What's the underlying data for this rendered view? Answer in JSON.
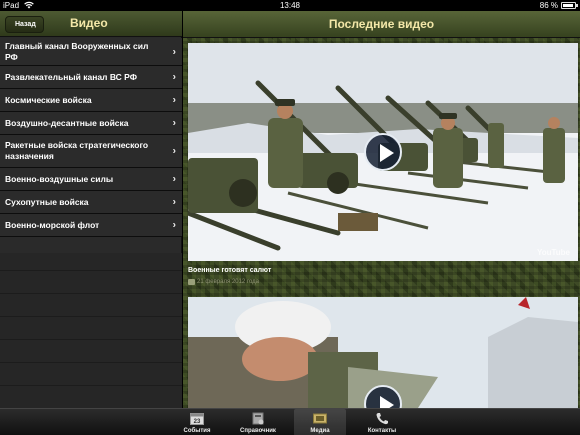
{
  "statusbar": {
    "carrier": "iPad",
    "time": "13:48",
    "battery": "86 %",
    "battery_level": 0.86
  },
  "left_panel": {
    "back_label": "Назад",
    "title": "Видео",
    "items": [
      {
        "label": "Главный канал Вооруженных сил РФ"
      },
      {
        "label": "Развлекательный канал ВС РФ"
      },
      {
        "label": "Космические войска"
      },
      {
        "label": "Воздушно-десантные войска"
      },
      {
        "label": "Ракетные войска стратегического назначения"
      },
      {
        "label": "Военно-воздушные силы"
      },
      {
        "label": "Сухопутные войска"
      },
      {
        "label": "Военно-морской флот"
      }
    ]
  },
  "right_panel": {
    "title": "Последние видео",
    "videos": [
      {
        "title": "Военные готовят салют",
        "date": "21 февраля 2012 года"
      },
      {
        "title": "",
        "date": ""
      }
    ]
  },
  "tabbar": {
    "tabs": [
      {
        "label": "События",
        "icon": "calendar-icon"
      },
      {
        "label": "Справочник",
        "icon": "book-icon"
      },
      {
        "label": "Медиа",
        "icon": "film-icon",
        "active": true
      },
      {
        "label": "Контакты",
        "icon": "phone-icon"
      }
    ]
  }
}
